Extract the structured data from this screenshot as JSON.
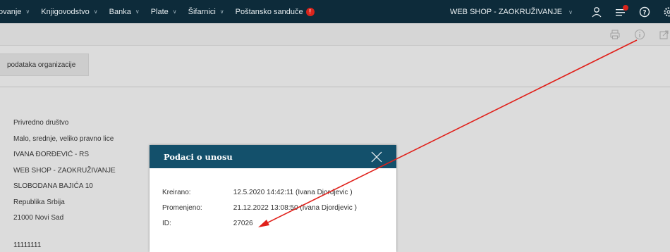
{
  "nav": {
    "items": [
      {
        "label": "ovanje",
        "dropdown": true
      },
      {
        "label": "Knjigovodstvo",
        "dropdown": true
      },
      {
        "label": "Banka",
        "dropdown": true
      },
      {
        "label": "Plate",
        "dropdown": true
      },
      {
        "label": "Šifarnici",
        "dropdown": true
      },
      {
        "label": "Poštansko sanduče",
        "dropdown": false,
        "badge": "!"
      }
    ],
    "organization": "WEB SHOP - ZAOKRUŽIVANJE",
    "icons": [
      "user-icon",
      "notifications-icon",
      "help-icon",
      "settings-icon"
    ]
  },
  "toolbar": {
    "icons": [
      "print-icon",
      "info-icon",
      "export-icon"
    ]
  },
  "tab": {
    "label": "podataka organizacije"
  },
  "org_info": {
    "lines": [
      "Privredno društvo",
      "Malo, srednje, veliko pravno lice",
      "IVANA ĐORĐEVIĆ - RS",
      "WEB SHOP - ZAOKRUŽIVANJE",
      "SLOBODANA BAJIĆA 10",
      "Republika Srbija",
      "21000 Novi Sad"
    ],
    "extra": "11111111"
  },
  "modal": {
    "title": "Podaci o unosu",
    "created_label": "Kreirano:",
    "created_value": "12.5.2020 14:42:11 (Ivana Djordjevic )",
    "modified_label": "Promenjeno:",
    "modified_value": "21.12.2022 13:08:50 (Ivana Djordjevic )",
    "id_label": "ID:",
    "id_value": "27026"
  },
  "colors": {
    "nav_bg": "#0d2b3a",
    "modal_header": "#13506b",
    "badge": "#d9241b",
    "annotation_arrow": "#e0201a"
  }
}
